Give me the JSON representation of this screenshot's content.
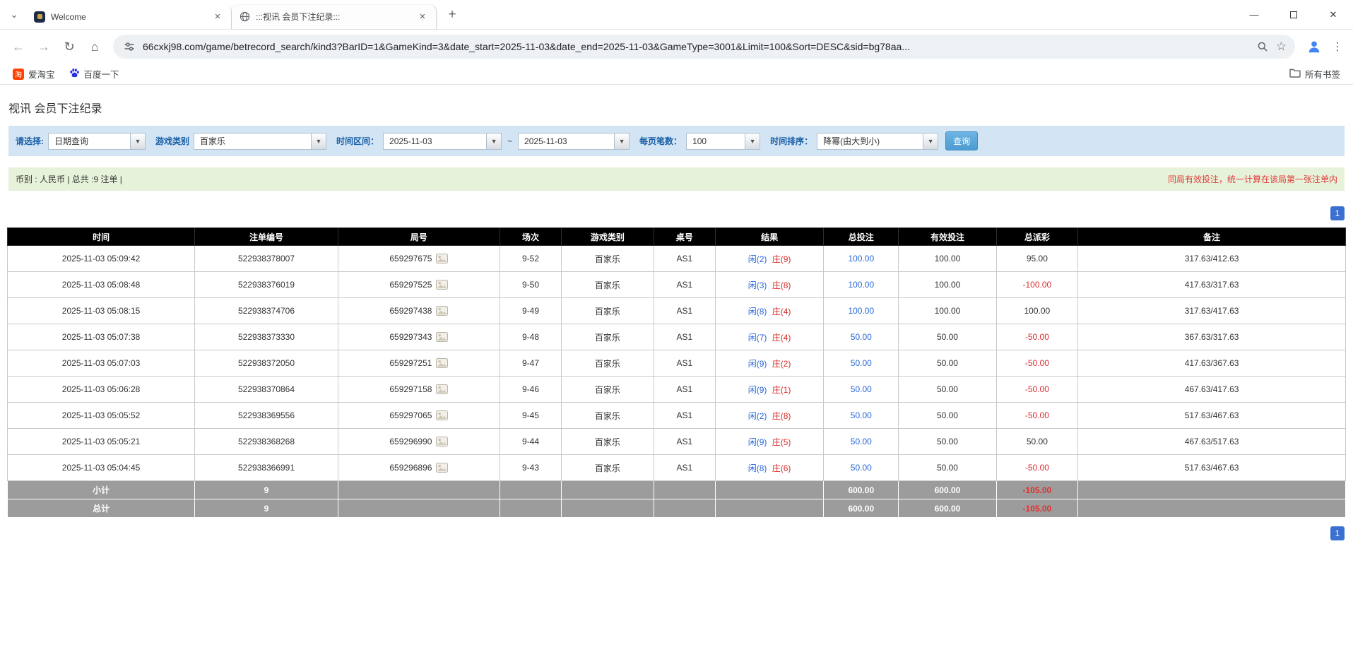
{
  "browser": {
    "tabs": [
      {
        "title": "Welcome",
        "active": false
      },
      {
        "title": ":::视讯 会员下注纪录:::",
        "active": true
      }
    ],
    "url": "66cxkj98.com/game/betrecord_search/kind3?BarID=1&GameKind=3&date_start=2025-11-03&date_end=2025-11-03&GameType=3001&Limit=100&Sort=DESC&sid=bg78aa...",
    "bookmarks": [
      {
        "label": "爱淘宝"
      },
      {
        "label": "百度一下"
      }
    ],
    "all_bookmarks_label": "所有书签"
  },
  "page": {
    "title": "视讯 会员下注纪录",
    "filters": {
      "select_label": "请选择:",
      "select_value": "日期查询",
      "game_label": "游戏类别",
      "game_value": "百家乐",
      "range_label": "时间区间：",
      "date_start": "2025-11-03",
      "range_sep": "~",
      "date_end": "2025-11-03",
      "page_size_label": "每页笔数：",
      "page_size_value": "100",
      "sort_label": "时间排序：",
      "sort_value": "降幂(由大到小)",
      "search_button": "查询"
    },
    "summary_left": "币别 : 人民币 | 总共 :9 注单 |",
    "summary_right": "同局有效投注，统一计算在该局第一张注单内",
    "pager_page": "1",
    "table": {
      "headers": [
        "时间",
        "注单编号",
        "局号",
        "场次",
        "游戏类别",
        "桌号",
        "结果",
        "总投注",
        "有效投注",
        "总派彩",
        "备注"
      ],
      "rows": [
        {
          "time": "2025-11-03 05:09:42",
          "bet_id": "522938378007",
          "round_id": "659297675",
          "session": "9-52",
          "game": "百家乐",
          "table_no": "AS1",
          "result_player": "闲(2)",
          "result_banker": "庄(9)",
          "total_bet": "100.00",
          "valid_bet": "100.00",
          "payout": "95.00",
          "note": "317.63/412.63"
        },
        {
          "time": "2025-11-03 05:08:48",
          "bet_id": "522938376019",
          "round_id": "659297525",
          "session": "9-50",
          "game": "百家乐",
          "table_no": "AS1",
          "result_player": "闲(3)",
          "result_banker": "庄(8)",
          "total_bet": "100.00",
          "valid_bet": "100.00",
          "payout": "-100.00",
          "note": "417.63/317.63"
        },
        {
          "time": "2025-11-03 05:08:15",
          "bet_id": "522938374706",
          "round_id": "659297438",
          "session": "9-49",
          "game": "百家乐",
          "table_no": "AS1",
          "result_player": "闲(8)",
          "result_banker": "庄(4)",
          "total_bet": "100.00",
          "valid_bet": "100.00",
          "payout": "100.00",
          "note": "317.63/417.63"
        },
        {
          "time": "2025-11-03 05:07:38",
          "bet_id": "522938373330",
          "round_id": "659297343",
          "session": "9-48",
          "game": "百家乐",
          "table_no": "AS1",
          "result_player": "闲(7)",
          "result_banker": "庄(4)",
          "total_bet": "50.00",
          "valid_bet": "50.00",
          "payout": "-50.00",
          "note": "367.63/317.63"
        },
        {
          "time": "2025-11-03 05:07:03",
          "bet_id": "522938372050",
          "round_id": "659297251",
          "session": "9-47",
          "game": "百家乐",
          "table_no": "AS1",
          "result_player": "闲(9)",
          "result_banker": "庄(2)",
          "total_bet": "50.00",
          "valid_bet": "50.00",
          "payout": "-50.00",
          "note": "417.63/367.63"
        },
        {
          "time": "2025-11-03 05:06:28",
          "bet_id": "522938370864",
          "round_id": "659297158",
          "session": "9-46",
          "game": "百家乐",
          "table_no": "AS1",
          "result_player": "闲(9)",
          "result_banker": "庄(1)",
          "total_bet": "50.00",
          "valid_bet": "50.00",
          "payout": "-50.00",
          "note": "467.63/417.63"
        },
        {
          "time": "2025-11-03 05:05:52",
          "bet_id": "522938369556",
          "round_id": "659297065",
          "session": "9-45",
          "game": "百家乐",
          "table_no": "AS1",
          "result_player": "闲(2)",
          "result_banker": "庄(8)",
          "total_bet": "50.00",
          "valid_bet": "50.00",
          "payout": "-50.00",
          "note": "517.63/467.63"
        },
        {
          "time": "2025-11-03 05:05:21",
          "bet_id": "522938368268",
          "round_id": "659296990",
          "session": "9-44",
          "game": "百家乐",
          "table_no": "AS1",
          "result_player": "闲(9)",
          "result_banker": "庄(5)",
          "total_bet": "50.00",
          "valid_bet": "50.00",
          "payout": "50.00",
          "note": "467.63/517.63"
        },
        {
          "time": "2025-11-03 05:04:45",
          "bet_id": "522938366991",
          "round_id": "659296896",
          "session": "9-43",
          "game": "百家乐",
          "table_no": "AS1",
          "result_player": "闲(8)",
          "result_banker": "庄(6)",
          "total_bet": "50.00",
          "valid_bet": "50.00",
          "payout": "-50.00",
          "note": "517.63/467.63"
        }
      ],
      "subtotal": {
        "label": "小计",
        "count": "9",
        "total_bet": "600.00",
        "valid_bet": "600.00",
        "payout": "-105.00"
      },
      "total": {
        "label": "总计",
        "count": "9",
        "total_bet": "600.00",
        "valid_bet": "600.00",
        "payout": "-105.00"
      }
    }
  }
}
